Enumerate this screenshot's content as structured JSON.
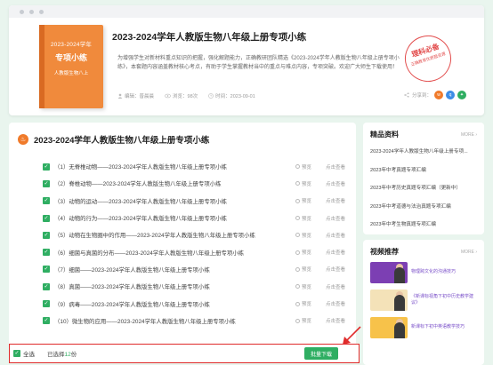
{
  "hero": {
    "title": "2023-2024学年人教版生物八年级上册专项小练",
    "cover": {
      "year": "2023-2024学年",
      "type": "专项小练",
      "subtitle": "人教版生物八上"
    },
    "description": "为增强学生对新材料重点知识的把握，强化解题能力，正确教研团队精选《2023-2024学年人教版生物八年级上册专项小练》，本套题内容涵盖教材核心考点，有助于学生掌握教材当中的重点与难点内容，专项突破。欢迎广大师生下载使用！",
    "stamp": {
      "main": "理科必备",
      "sub": "正确教育优质题资源"
    },
    "meta": {
      "editor": "编辑：普晨晨",
      "views": "浏览：98次",
      "time": "时间：2023-09-01"
    },
    "share_label": "分享到："
  },
  "main": {
    "title": "2023-2024学年人教版生物八年级上册专项小练",
    "preview_label": "预览",
    "download_label": "点击查看",
    "items": [
      "（1）无脊椎动物——2023-2024学年人教版生物八年级上册专项小练",
      "（2）脊椎动物——2023-2024学年人教版生物八年级上册专项小练",
      "（3）动物的运动——2023-2024学年人教版生物八年级上册专项小练",
      "（4）动物的行为——2023-2024学年人教版生物八年级上册专项小练",
      "（5）动物在生物圈中的作用——2023-2024学年人教版生物八年级上册专项小练",
      "（6）细菌与真菌的分布——2023-2024学年人教版生物八年级上册专项小练",
      "（7）细菌——2023-2024学年人教版生物八年级上册专项小练",
      "（8）真菌——2023-2024学年人教版生物八年级上册专项小练",
      "（9）病毒——2023-2024学年人教版生物八年级上册专项小练",
      "（10）微生物的应用——2023-2024学年人教版生物八年级上册专项小练"
    ]
  },
  "actionbar": {
    "select_all": "全选",
    "selected_prefix": "已选择",
    "selected_count": "12",
    "selected_suffix": "份",
    "batch_download": "批量下载"
  },
  "sidebar": {
    "featured": {
      "title": "精品资料",
      "more": "MORE",
      "items": [
        "2023-2024学年人教版生物八年级上册专项...",
        "2023年中考真题专项汇编",
        "2023年中考历史真题专项汇编（更新中）",
        "2023年中考道德与法治真题专项汇编",
        "2023年中考生物真题专项汇编"
      ]
    },
    "videos": {
      "title": "视频推荐",
      "more": "MORE",
      "items": [
        "物理跨文化的沟通技巧",
        "《新课标视角下初中历史教学建议》",
        "新课标下初中英语教学技巧"
      ]
    }
  },
  "colors": {
    "accent": "#2fae62",
    "highlight_border": "#e02b2b",
    "cover": "#f08a3c",
    "stamp": "#e24c4c"
  }
}
